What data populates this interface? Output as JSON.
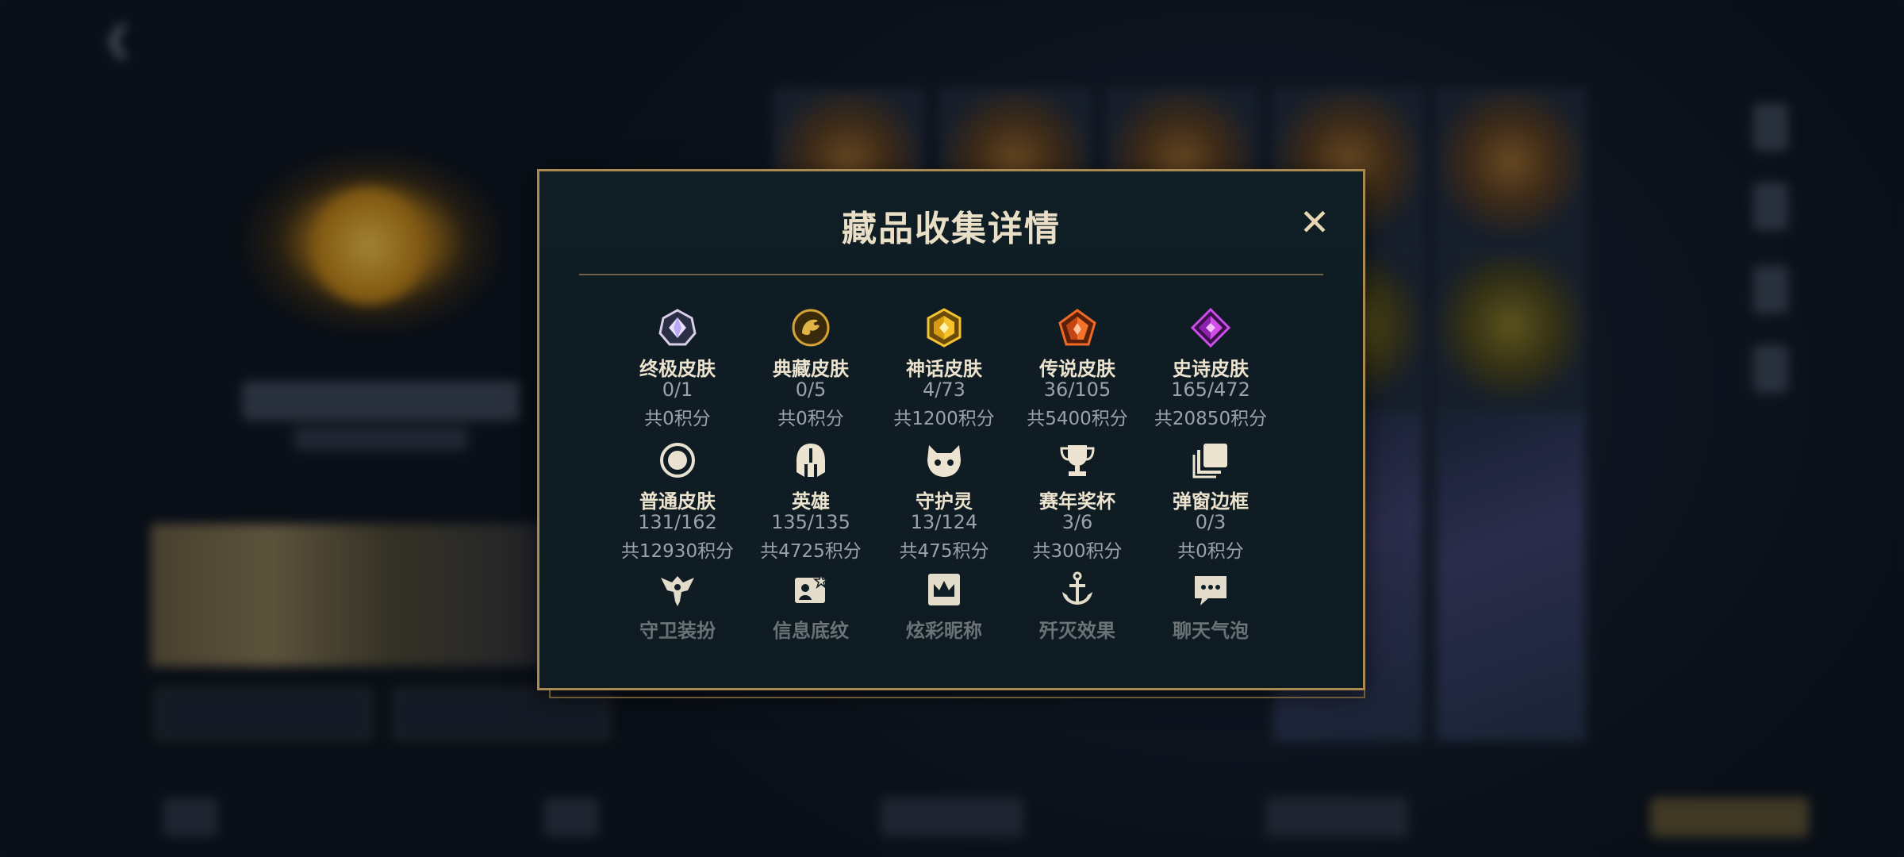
{
  "modal": {
    "title": "藏品收集详情",
    "close_symbol": "✕"
  },
  "rows": [
    [
      {
        "icon": "ultimate-skin-gem-icon",
        "label": "终极皮肤",
        "count": "0/1",
        "points": "共0积分"
      },
      {
        "icon": "prestige-skin-dragon-icon",
        "label": "典藏皮肤",
        "count": "0/5",
        "points": "共0积分"
      },
      {
        "icon": "mythic-skin-gem-icon",
        "label": "神话皮肤",
        "count": "4/73",
        "points": "共1200积分"
      },
      {
        "icon": "legendary-skin-gem-icon",
        "label": "传说皮肤",
        "count": "36/105",
        "points": "共5400积分"
      },
      {
        "icon": "epic-skin-gem-icon",
        "label": "史诗皮肤",
        "count": "165/472",
        "points": "共20850积分"
      }
    ],
    [
      {
        "icon": "normal-skin-ring-icon",
        "label": "普通皮肤",
        "count": "131/162",
        "points": "共12930积分"
      },
      {
        "icon": "champion-helmet-icon",
        "label": "英雄",
        "count": "135/135",
        "points": "共4725积分"
      },
      {
        "icon": "little-legend-icon",
        "label": "守护灵",
        "count": "13/124",
        "points": "共475积分"
      },
      {
        "icon": "trophy-icon",
        "label": "赛年奖杯",
        "count": "3/6",
        "points": "共300积分"
      },
      {
        "icon": "popup-frame-icon",
        "label": "弹窗边框",
        "count": "0/3",
        "points": "共0积分"
      }
    ],
    [
      {
        "icon": "ward-skin-icon",
        "label": "守卫装扮"
      },
      {
        "icon": "banner-card-icon",
        "label": "信息底纹"
      },
      {
        "icon": "name-crown-icon",
        "label": "炫彩昵称"
      },
      {
        "icon": "elimination-anchor-icon",
        "label": "歼灭效果"
      },
      {
        "icon": "chat-bubble-icon",
        "label": "聊天气泡"
      }
    ]
  ],
  "colors": {
    "gold_border": "#a8894f",
    "modal_bg": "#0f1d24",
    "label": "#ece3cf",
    "muted": "#9aa3a9"
  }
}
